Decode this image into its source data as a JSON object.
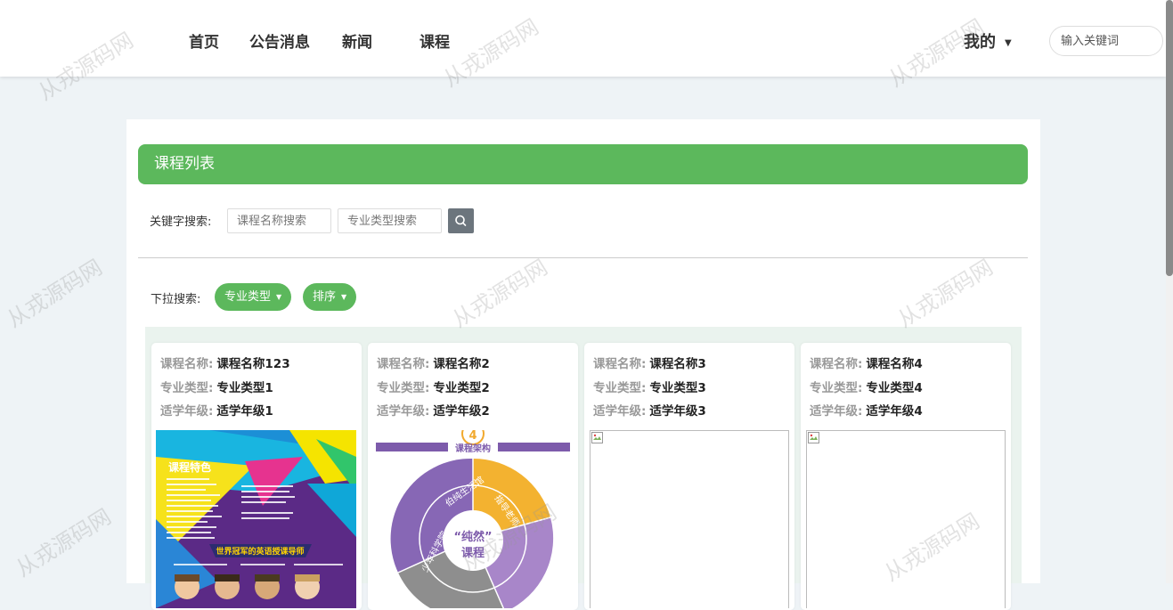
{
  "nav": {
    "items": [
      "首页",
      "公告消息",
      "新闻",
      "课程"
    ],
    "mine_label": "我的",
    "search_placeholder": "输入关键词"
  },
  "course_list": {
    "title": "课程列表",
    "keyword_label": "关键字搜索:",
    "name_placeholder": "课程名称搜索",
    "type_placeholder": "专业类型搜索",
    "dropdown_label": "下拉搜索:",
    "type_dropdown": "专业类型",
    "sort_dropdown": "排序"
  },
  "card_labels": {
    "name": "课程名称:",
    "type": "专业类型:",
    "grade": "适学年级:"
  },
  "cards": [
    {
      "name": "课程名称123",
      "type": "专业类型1",
      "grade": "适学年级1",
      "image": "poster-english-course"
    },
    {
      "name": "课程名称2",
      "type": "专业类型2",
      "grade": "适学年级2",
      "image": "poster-course-structure"
    },
    {
      "name": "课程名称3",
      "type": "专业类型3",
      "grade": "适学年级3",
      "image": "broken-image"
    },
    {
      "name": "课程名称4",
      "type": "专业类型4",
      "grade": "适学年级4",
      "image": "broken-image"
    }
  ],
  "poster1": {
    "heading": "课程特色",
    "banner": "世界冠军的英语授课导师"
  },
  "poster2": {
    "badge_number": "4",
    "heading": "课程架构",
    "center_line1": "“纯然”",
    "center_line2": "课程",
    "segment_left": "伯纯生活馆",
    "segment_right": "指导老师",
    "segment_bottom": "少年科学院"
  },
  "watermark": "从戎源码网",
  "colors": {
    "accent_green": "#5cb85c",
    "search_button": "#6c757d",
    "card_area_bg": "#eaf3ee"
  }
}
